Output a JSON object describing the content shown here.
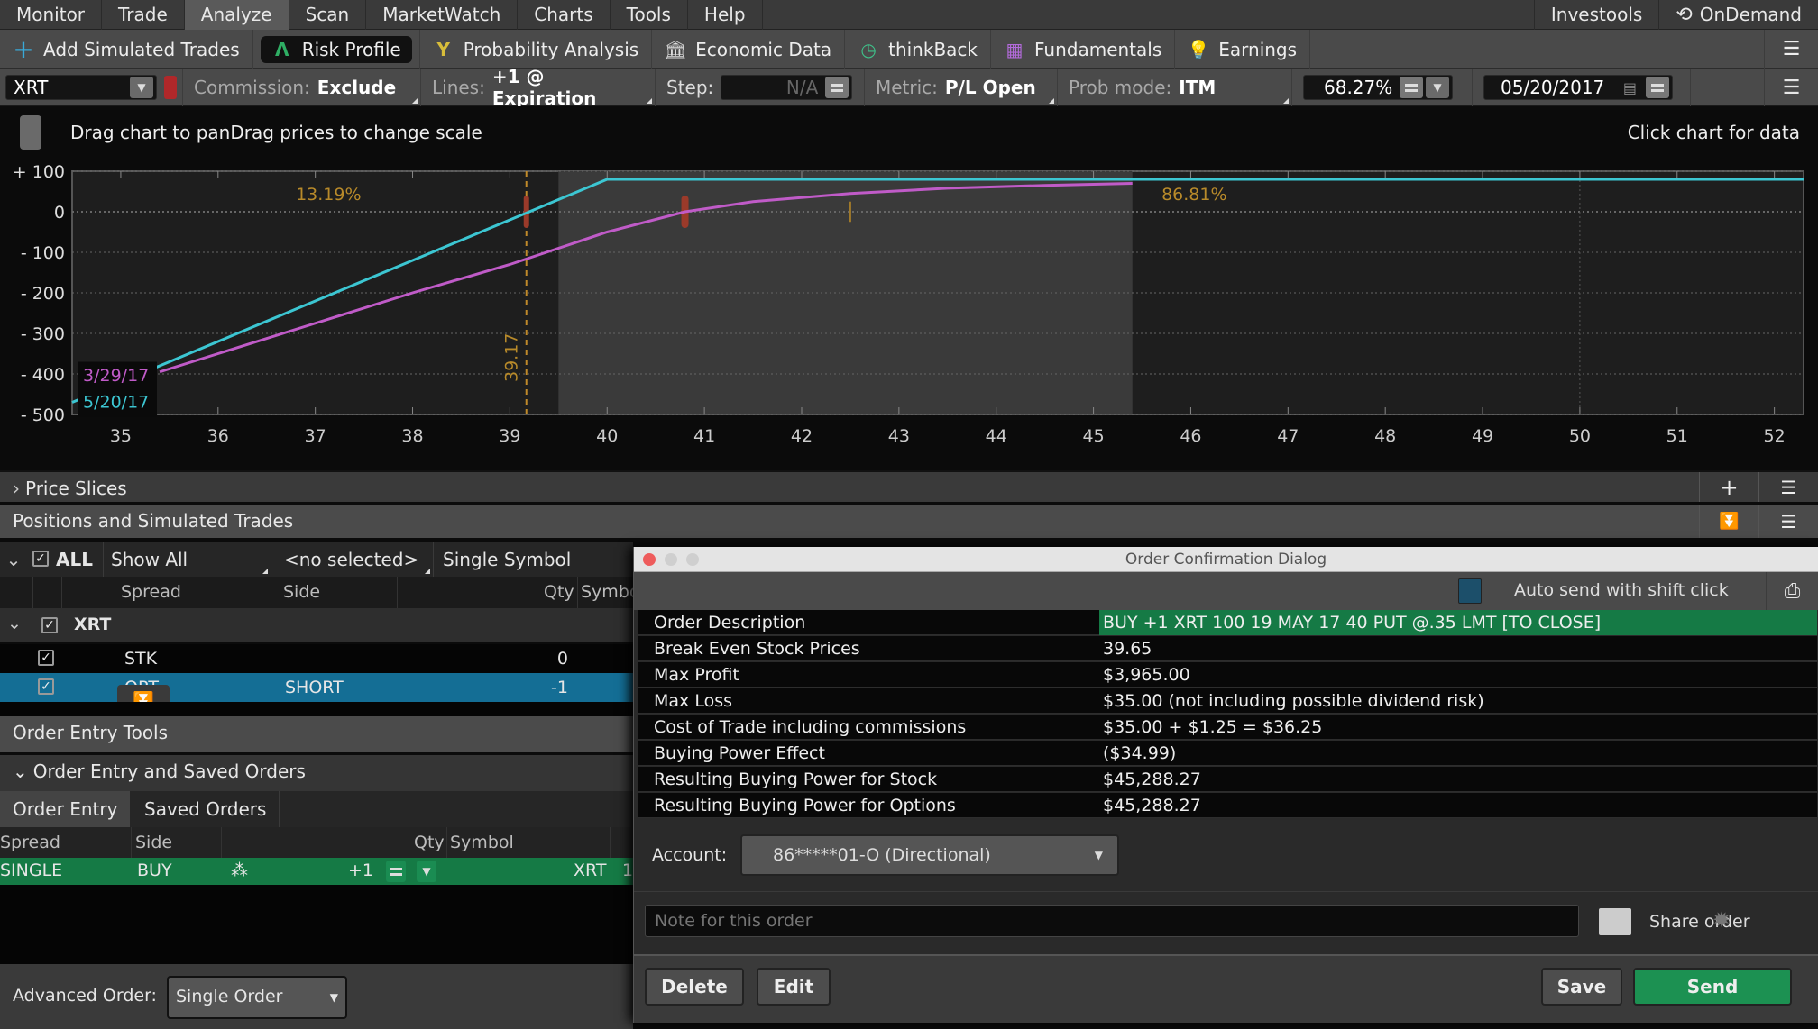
{
  "menu": {
    "items": [
      "Monitor",
      "Trade",
      "Analyze",
      "Scan",
      "MarketWatch",
      "Charts",
      "Tools",
      "Help"
    ],
    "active": "Analyze",
    "right_items": [
      "Investools",
      "OnDemand"
    ]
  },
  "tools": {
    "add_simulated": "Add Simulated Trades",
    "risk_profile": "Risk Profile",
    "probability_analysis": "Probability Analysis",
    "economic_data": "Economic Data",
    "thinkback": "thinkBack",
    "fundamentals": "Fundamentals",
    "earnings": "Earnings"
  },
  "controls": {
    "symbol": "XRT",
    "commission_label": "Commission:",
    "commission_value": "Exclude",
    "lines_label": "Lines:",
    "lines_value": "+1 @ Expiration",
    "step_label": "Step:",
    "step_value": "N/A",
    "metric_label": "Metric:",
    "metric_value": "P/L Open",
    "prob_mode_label": "Prob mode:",
    "prob_mode_value": "ITM",
    "prob_range": "68.27%",
    "date": "05/20/2017"
  },
  "chart_header": {
    "hint": "Drag chart to panDrag prices to change scale",
    "click_hint": "Click chart for data"
  },
  "chart_data": {
    "type": "line",
    "title": "",
    "xlabel": "",
    "ylabel": "",
    "xlim": [
      34.5,
      52.3
    ],
    "ylim": [
      -500,
      100
    ],
    "x_ticks": [
      35,
      36,
      37,
      38,
      39,
      40,
      41,
      42,
      43,
      44,
      45,
      46,
      47,
      48,
      49,
      50,
      51,
      52
    ],
    "y_ticks": [
      100,
      0,
      -100,
      -200,
      -300,
      -400,
      -500
    ],
    "y_tick_labels": [
      "+ 100",
      "0",
      "- 100",
      "- 200",
      "- 300",
      "- 400",
      "- 500"
    ],
    "grid": true,
    "series": [
      {
        "name": "5/20/17",
        "color": "#3cc6d2",
        "x": [
          34.5,
          35.0,
          36.0,
          37.0,
          38.0,
          39.0,
          39.65,
          40.0,
          52.3
        ],
        "y": [
          -470,
          -420,
          -320,
          -220,
          -120,
          -20,
          45,
          80,
          80
        ]
      },
      {
        "name": "3/29/17",
        "color": "#c05bc8",
        "x": [
          35.4,
          36.0,
          37.0,
          38.0,
          39.0,
          40.0,
          40.8,
          41.5,
          42.5,
          43.5,
          44.5,
          45.4
        ],
        "y": [
          -395,
          -350,
          -275,
          -200,
          -130,
          -50,
          0,
          25,
          45,
          58,
          65,
          70
        ]
      }
    ],
    "annotations": [
      {
        "text": "13.19%",
        "x": 36.8,
        "y": 45,
        "color": "#b88a2a"
      },
      {
        "text": "86.81%",
        "x": 45.7,
        "y": 45,
        "color": "#b88a2a"
      },
      {
        "text": "39.17",
        "x": 39.17,
        "rotated": true,
        "color": "#b88a2a"
      }
    ],
    "probability_band": {
      "low": 39.5,
      "high": 45.4
    },
    "breakeven_marker": 39.17,
    "current_price_marker": 40.8,
    "reference_marker": 42.5,
    "legend": [
      "3/29/17",
      "5/20/17"
    ],
    "legend_placement": "bottom-left"
  },
  "price_slices": {
    "title": "Price Slices"
  },
  "positions": {
    "title": "Positions and Simulated Trades",
    "all_label": "ALL",
    "filter": "Show All",
    "selected": "<no selected>",
    "mode": "Single Symbol",
    "columns": [
      "Spread",
      "Side",
      "Qty",
      "Symbol"
    ],
    "group": "XRT",
    "rows": [
      {
        "spread": "STK",
        "side": "",
        "qty": "0"
      },
      {
        "spread": "OPT",
        "side": "SHORT",
        "qty": "-1"
      }
    ]
  },
  "order_entry_tools": {
    "title": "Order Entry Tools"
  },
  "order_entry": {
    "title": "Order Entry and Saved Orders",
    "tabs": [
      "Order Entry",
      "Saved Orders"
    ],
    "columns": [
      "Spread",
      "Side",
      "Qty",
      "Symbol"
    ],
    "row": {
      "spread": "SINGLE",
      "side": "BUY",
      "qty": "+1",
      "symbol": "XRT",
      "extra": "1"
    },
    "advanced_label": "Advanced Order:",
    "advanced_value": "Single Order"
  },
  "dialog": {
    "title": "Order Confirmation Dialog",
    "auto_send": "Auto send with shift click",
    "rows": [
      {
        "key": "Order Description",
        "value": "BUY +1 XRT 100 19 MAY 17 40 PUT @.35 LMT [TO CLOSE]"
      },
      {
        "key": "Break Even Stock Prices",
        "value": "39.65"
      },
      {
        "key": "Max Profit",
        "value": "$3,965.00"
      },
      {
        "key": "Max Loss",
        "value": "$35.00 (not including possible dividend risk)"
      },
      {
        "key": "Cost of Trade including commissions",
        "value": "$35.00 + $1.25 = $36.25"
      },
      {
        "key": "Buying Power Effect",
        "value": "($34.99)"
      },
      {
        "key": "Resulting Buying Power for Stock",
        "value": "$45,288.27"
      },
      {
        "key": "Resulting Buying Power for Options",
        "value": "$45,288.27"
      }
    ],
    "account_label": "Account:",
    "account_value": "86*****01-O (Directional)",
    "note_placeholder": "Note for this order",
    "share_label": "Share order",
    "buttons": {
      "delete": "Delete",
      "edit": "Edit",
      "save": "Save",
      "send": "Send"
    }
  }
}
